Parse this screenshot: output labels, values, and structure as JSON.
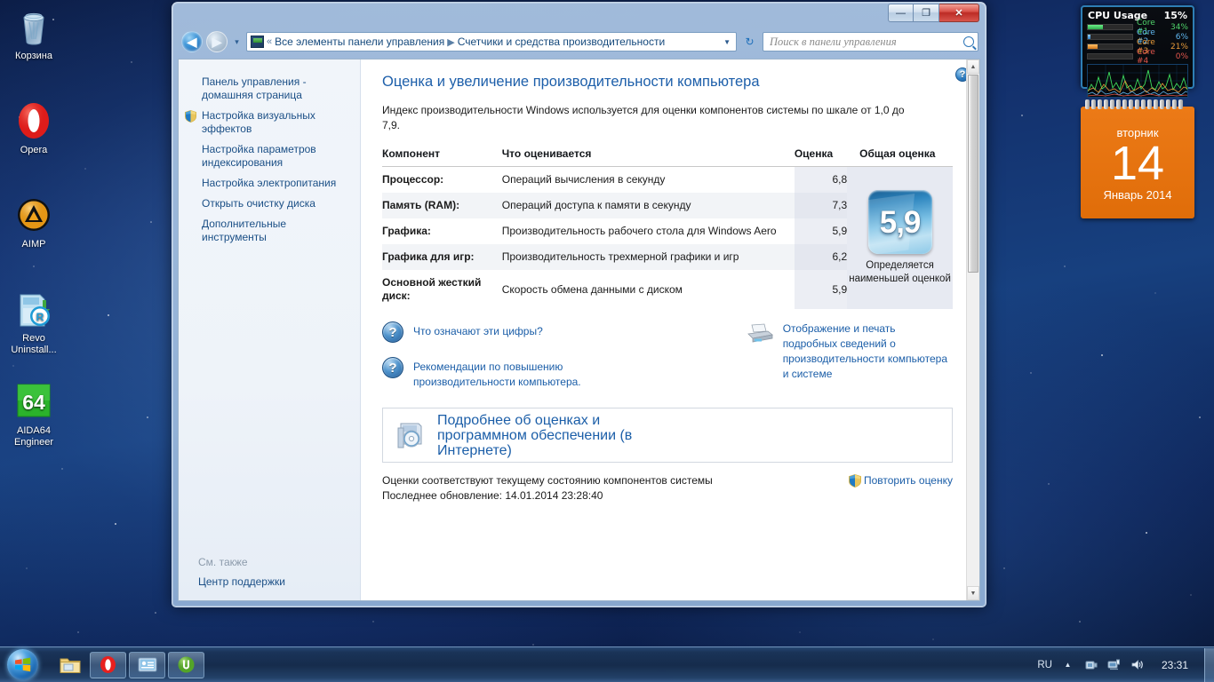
{
  "desktop": {
    "icons": [
      {
        "name": "recycle-bin",
        "label": "Корзина"
      },
      {
        "name": "opera",
        "label": "Opera"
      },
      {
        "name": "aimp",
        "label": "AIMP"
      },
      {
        "name": "revo-uninstaller",
        "label": "Revo\nUninstall..."
      },
      {
        "name": "aida64",
        "label": "AIDA64\nEngineer"
      }
    ]
  },
  "window": {
    "buttons": {
      "minimize": "—",
      "maximize": "❐",
      "close": "✕"
    },
    "address": {
      "back_label": "◀",
      "forward_label": "▶",
      "history_label": "▾",
      "chevrons": "«",
      "crumb1": "Все элементы панели управления",
      "crumb_sep": "▶",
      "crumb2": "Счетчики и средства производительности",
      "dropdown": "▼",
      "refresh": "↻"
    },
    "search": {
      "placeholder": "Поиск в панели управления"
    }
  },
  "sidebar": {
    "links": [
      {
        "label": "Панель управления - домашняя страница",
        "shield": false
      },
      {
        "label": "Настройка визуальных эффектов",
        "shield": true
      },
      {
        "label": "Настройка параметров индексирования",
        "shield": false
      },
      {
        "label": "Настройка электропитания",
        "shield": false
      },
      {
        "label": "Открыть очистку диска",
        "shield": false
      },
      {
        "label": "Дополнительные инструменты",
        "shield": false
      }
    ],
    "see_also": {
      "header": "См. также",
      "link": "Центр поддержки"
    }
  },
  "main": {
    "help_icon": "?",
    "title": "Оценка и увеличение производительности компьютера",
    "intro": "Индекс производительности Windows используется для оценки компонентов системы по шкале от 1,0 до 7,9.",
    "table": {
      "headers": {
        "component": "Компонент",
        "what": "Что оценивается",
        "score": "Оценка",
        "total": "Общая оценка"
      },
      "rows": [
        {
          "component": "Процессор:",
          "what": "Операций вычисления в секунду",
          "score": "6,8"
        },
        {
          "component": "Память (RAM):",
          "what": "Операций доступа к памяти в секунду",
          "score": "7,3"
        },
        {
          "component": "Графика:",
          "what": "Производительность рабочего стола для Windows Aero",
          "score": "5,9"
        },
        {
          "component": "Графика для игр:",
          "what": "Производительность трехмерной графики и игр",
          "score": "6,2"
        },
        {
          "component": "Основной жесткий диск:",
          "what": "Скорость обмена данными с диском",
          "score": "5,9"
        }
      ],
      "base_score": "5,9",
      "base_caption": "Определяется наименьшей оценкой"
    },
    "links": {
      "what_numbers_mean": "Что означают эти цифры?",
      "recommendations": "Рекомендации по повышению производительности компьютера.",
      "print_details": "Отображение и печать подробных сведений о производительности компьютера и системе",
      "more_info": "Подробнее об оценках и программном обеспечении (в Интернете)"
    },
    "status": {
      "line1": "Оценки соответствуют текущему состоянию компонентов системы",
      "line2": "Последнее обновление: 14.01.2014 23:28:40",
      "redo_label": "Повторить оценку"
    }
  },
  "gadgets": {
    "cpu": {
      "title": "CPU Usage",
      "total": "15%",
      "cores": [
        {
          "name": "Core #1",
          "pct": "34%",
          "value": 34,
          "color": "#39c659"
        },
        {
          "name": "Core #2",
          "pct": "6%",
          "value": 6,
          "color": "#4a9fe0"
        },
        {
          "name": "Core #3",
          "pct": "21%",
          "value": 21,
          "color": "#e08a22"
        },
        {
          "name": "Core #4",
          "pct": "0%",
          "value": 0,
          "color": "#d2453c"
        }
      ]
    },
    "calendar": {
      "weekday": "вторник",
      "day": "14",
      "month_year": "Январь 2014"
    }
  },
  "taskbar": {
    "start_label": "Пуск",
    "items": [
      {
        "name": "explorer",
        "label": "Проводник"
      },
      {
        "name": "opera",
        "label": "Opera"
      },
      {
        "name": "control-panel",
        "label": "Счетчики и средства производительности"
      },
      {
        "name": "utorrent",
        "label": "uTorrent"
      }
    ],
    "tray": {
      "language": "RU",
      "show_hidden": "▲",
      "clock": "23:31"
    }
  }
}
